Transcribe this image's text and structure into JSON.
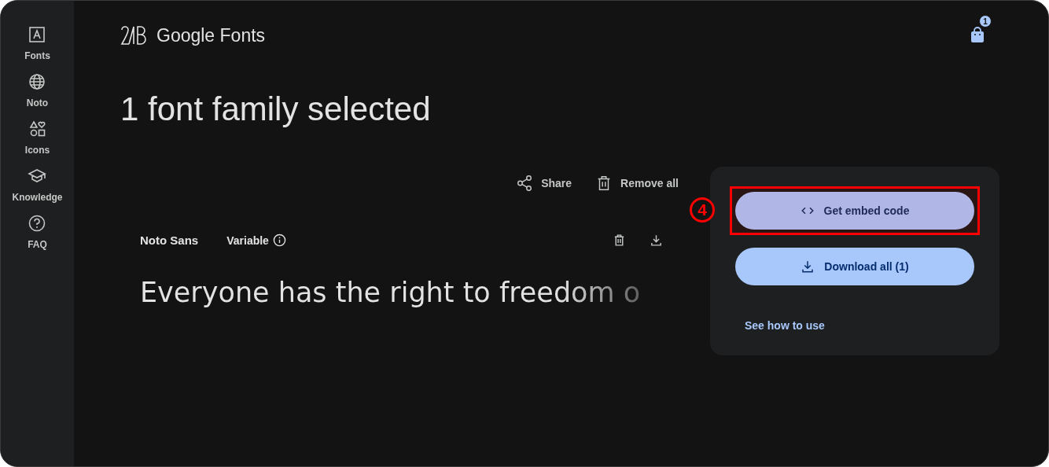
{
  "sidebar": {
    "items": [
      {
        "kind": "fonts",
        "label": "Fonts"
      },
      {
        "kind": "noto",
        "label": "Noto"
      },
      {
        "kind": "icons",
        "label": "Icons"
      },
      {
        "kind": "knowledge",
        "label": "Knowledge"
      },
      {
        "kind": "faq",
        "label": "FAQ"
      }
    ]
  },
  "header": {
    "logo_text": "Google Fonts",
    "cart_count": "1"
  },
  "title": "1 font family selected",
  "actions": [
    {
      "kind": "share",
      "label": "Share"
    },
    {
      "kind": "remove",
      "label": "Remove all"
    }
  ],
  "families": [
    {
      "name": "Noto Sans",
      "type": "Variable",
      "sample": "Everyone has the right to freedom o"
    }
  ],
  "panel": {
    "buttons": [
      {
        "kind": "embed",
        "label": "Get embed code",
        "highlighted": true,
        "marker": "4"
      },
      {
        "kind": "download",
        "label": "Download all (1)",
        "highlighted": false
      }
    ],
    "link": "See how to use"
  }
}
